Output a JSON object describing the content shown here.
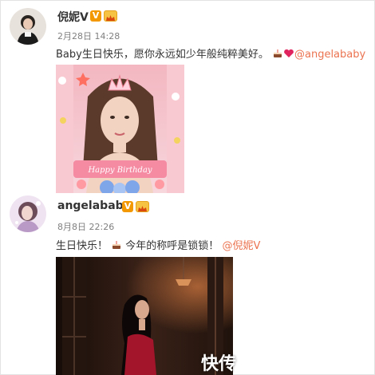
{
  "posts": [
    {
      "username": "倪妮V",
      "badge_v": "V",
      "date": "2月28日 14:28",
      "text": "Baby生日快乐，愿你永远如少年般纯粹美好。",
      "emoji1": "cake-emoji",
      "emoji2": "heart-emoji",
      "mention": "@angelababy",
      "image_caption": "Happy Birthday"
    },
    {
      "username": "angelababy",
      "badge_v": "V",
      "date": "8月8日 22:26",
      "text_before": "生日快乐！",
      "text_after": " 今年的称呼是锁锁！",
      "emoji": "cake-emoji",
      "mention": "@倪妮V",
      "watermark": "快传"
    }
  ],
  "colors": {
    "mention": "#eb7350",
    "meta": "#808080",
    "verified": "#f39800"
  }
}
